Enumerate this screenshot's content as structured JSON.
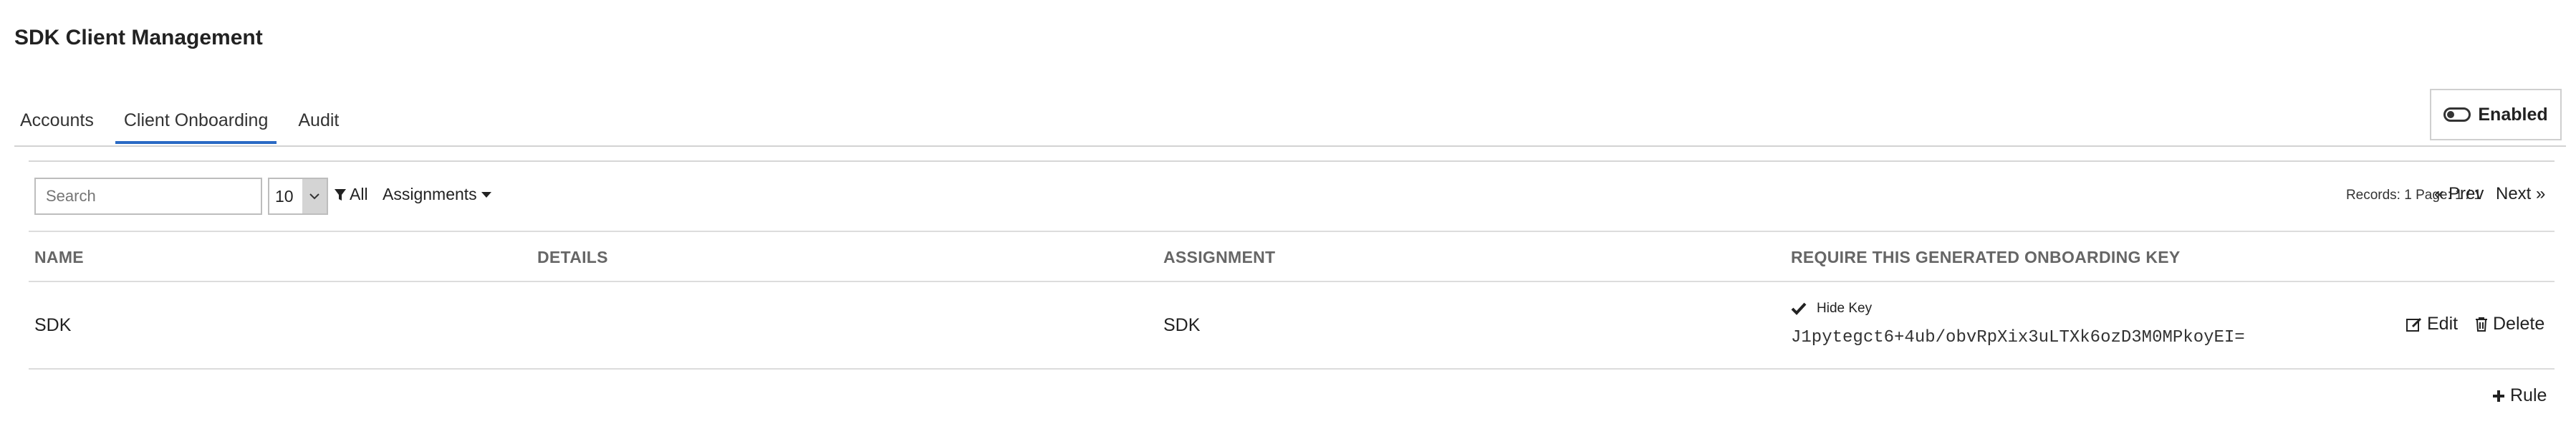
{
  "header": {
    "title": "SDK Client Management"
  },
  "tabs": [
    {
      "label": "Accounts",
      "active": false
    },
    {
      "label": "Client Onboarding",
      "active": true
    },
    {
      "label": "Audit",
      "active": false
    }
  ],
  "status_toggle": {
    "label": "Enabled",
    "state": "on"
  },
  "toolbar": {
    "search_placeholder": "Search",
    "page_size": "10",
    "filter_label": "All",
    "assignments_label": "Assignments"
  },
  "pagination": {
    "records_text": "Records: 1  Page: 1 / 1",
    "prev_label": "« Prev",
    "next_label": "Next »"
  },
  "table": {
    "columns": [
      "NAME",
      "DETAILS",
      "ASSIGNMENT",
      "REQUIRE THIS GENERATED ONBOARDING KEY"
    ],
    "rows": [
      {
        "name": "SDK",
        "details": "",
        "assignment": "SDK",
        "hide_key_label": "Hide Key",
        "onboarding_key": "J1pytegct6+4ub/obvRpXix3uLTXk6ozD3M0MPkoyEI=",
        "edit_label": "Edit",
        "delete_label": "Delete"
      }
    ]
  },
  "footer": {
    "add_rule_label": "Rule"
  },
  "colors": {
    "accent": "#2a6ac4",
    "header_text": "#666666",
    "border": "#d6d6d6"
  },
  "icons": [
    "toggle-on-icon",
    "filter-icon",
    "caret-down-icon",
    "check-icon",
    "edit-icon",
    "trash-icon",
    "plus-icon"
  ]
}
